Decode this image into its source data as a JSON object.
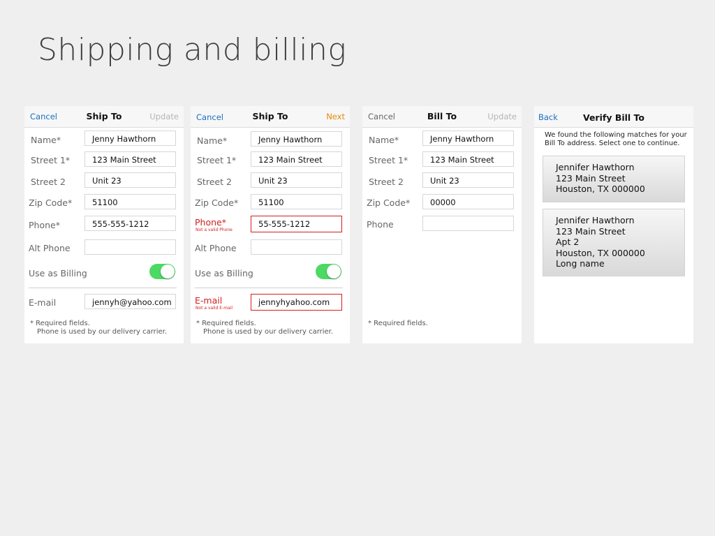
{
  "slide": {
    "title": "Shipping and billing"
  },
  "panel1": {
    "nav": {
      "left": "Cancel",
      "title": "Ship To",
      "right": "Update"
    },
    "fields": {
      "name": {
        "label": "Name*",
        "value": "Jenny Hawthorn"
      },
      "street1": {
        "label": "Street 1*",
        "value": "123 Main Street"
      },
      "street2": {
        "label": "Street 2",
        "value": "Unit 23"
      },
      "zip": {
        "label": "Zip Code*",
        "value": "51100"
      },
      "phone": {
        "label": "Phone*",
        "value": "555-555-1212"
      },
      "altphone": {
        "label": "Alt Phone",
        "value": ""
      },
      "billing": {
        "label": "Use as Billing",
        "on": true
      },
      "email": {
        "label": "E-mail",
        "value": "jennyh@yahoo.com"
      }
    },
    "note1": "* Required fields.",
    "note2": "Phone is used by our delivery carrier."
  },
  "panel2": {
    "nav": {
      "left": "Cancel",
      "title": "Ship To",
      "right": "Next"
    },
    "fields": {
      "name": {
        "label": "Name*",
        "value": "Jenny Hawthorn"
      },
      "street1": {
        "label": "Street 1*",
        "value": "123 Main Street"
      },
      "street2": {
        "label": "Street 2",
        "value": "Unit 23"
      },
      "zip": {
        "label": "Zip Code*",
        "value": "51100"
      },
      "phone": {
        "label": "Phone*",
        "value": "55-555-1212",
        "error": "Not a valid Phone"
      },
      "altphone": {
        "label": "Alt Phone",
        "value": ""
      },
      "billing": {
        "label": "Use as Billing",
        "on": true
      },
      "email": {
        "label": "E-mail",
        "value": "jennyhyahoo.com",
        "error": "Not a valid E-mail"
      }
    },
    "note1": "* Required fields.",
    "note2": "Phone is used by our delivery carrier.",
    "error_color": "#d21e1e"
  },
  "panel3": {
    "nav": {
      "left": "Cancel",
      "title": "Bill To",
      "right": "Update"
    },
    "fields": {
      "name": {
        "label": "Name*",
        "value": "Jenny Hawthorn"
      },
      "street1": {
        "label": "Street 1*",
        "value": "123 Main Street"
      },
      "street2": {
        "label": "Street 2",
        "value": "Unit 23"
      },
      "zip": {
        "label": "Zip Code*",
        "value": "00000"
      },
      "phone": {
        "label": "Phone",
        "value": ""
      }
    },
    "note1": "* Required fields."
  },
  "panel4": {
    "nav": {
      "left": "Back",
      "title": "Verify Bill To"
    },
    "message": "We found the following matches for your Bill To address. Select one to continue.",
    "matches": [
      {
        "lines": [
          "Jennifer Hawthorn",
          "123 Main Street",
          "Houston, TX 000000"
        ]
      },
      {
        "lines": [
          "Jennifer Hawthorn",
          "123 Main Street",
          "Apt 2",
          "Houston, TX 000000",
          "Long name"
        ]
      }
    ]
  },
  "colors": {
    "link_blue": "#1a6fc0",
    "next_orange": "#e8890c",
    "toggle_green": "#4cd964",
    "error_red": "#d21e1e"
  }
}
